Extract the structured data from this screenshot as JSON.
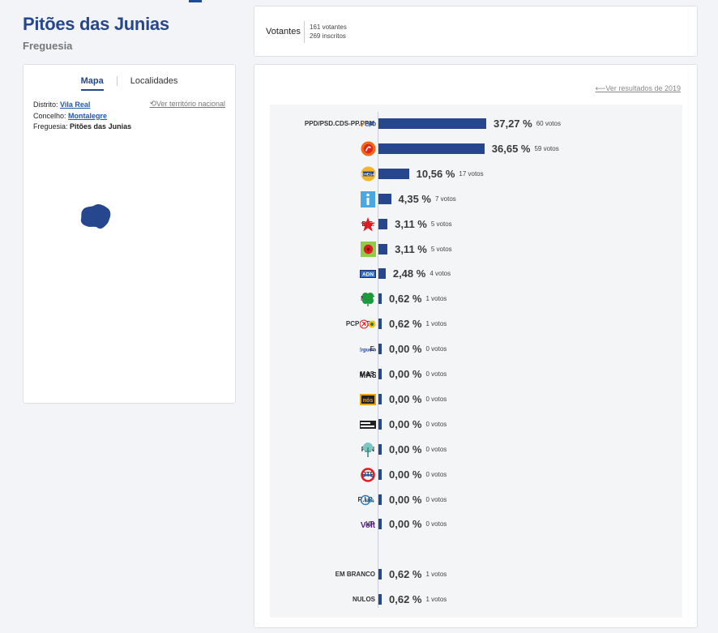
{
  "header": {
    "title": "Pitões das Junias",
    "subtitle": "Freguesia"
  },
  "left_panel": {
    "tabs": [
      {
        "label": "Mapa",
        "active": true
      },
      {
        "label": "Localidades",
        "active": false
      }
    ],
    "territory_link": "Ver território nacional",
    "info": {
      "distrito_label": "Distrito:",
      "distrito": "Vila Real",
      "concelho_label": "Concelho:",
      "concelho": "Montalegre",
      "freguesia_label": "Freguesia:",
      "freguesia": "Pitões das Junias"
    },
    "map_color": "#26478d"
  },
  "voters": {
    "label": "Votantes",
    "votantes": "161 votantes",
    "inscritos": "269 inscritos"
  },
  "results": {
    "previous_link": "Ver resultados de 2019",
    "accent": "#26478d",
    "chart_data": {
      "type": "bar",
      "orientation": "horizontal",
      "categories": [
        "PPD/PSD.CDS-PP.PPM",
        "PS",
        "CH",
        "IL",
        "B.E.",
        "L",
        "ADN",
        "MPT",
        "PCP-PEV",
        "E",
        "MAS",
        "NC",
        "ND",
        "PAN",
        "PTP",
        "R.I.R.",
        "VP",
        "EM BRANCO",
        "NULOS"
      ],
      "values": [
        37.27,
        36.65,
        10.56,
        4.35,
        3.11,
        3.11,
        2.48,
        0.62,
        0.62,
        0.0,
        0.0,
        0.0,
        0.0,
        0.0,
        0.0,
        0.0,
        0.0,
        0.62,
        0.62
      ],
      "value_labels": [
        "37,27 %",
        "36,65 %",
        "10,56 %",
        "4,35 %",
        "3,11 %",
        "3,11 %",
        "2,48 %",
        "0,62 %",
        "0,62 %",
        "0,00 %",
        "0,00 %",
        "0,00 %",
        "0,00 %",
        "0,00 %",
        "0,00 %",
        "0,00 %",
        "0,00 %",
        "0,62 %",
        "0,62 %"
      ],
      "votes": [
        "60 votos",
        "59 votos",
        "17 votos",
        "7 votos",
        "5 votos",
        "5 votos",
        "4 votos",
        "1 votos",
        "1 votos",
        "0 votos",
        "0 votos",
        "0 votos",
        "0 votos",
        "0 votos",
        "0 votos",
        "0 votos",
        "0 votos",
        "1 votos",
        "1 votos"
      ],
      "logos": [
        "ppd-psd-coalition-logo",
        "ps-logo",
        "chega-logo",
        "il-logo",
        "be-logo",
        "livre-logo",
        "adn-logo",
        "mpt-logo",
        "pcp-pev-logo",
        "ergue-te-logo",
        "mas-logo",
        "nc-logo",
        "nd-logo",
        "pan-logo",
        "ptp-logo",
        "rir-logo",
        "volt-logo",
        "",
        ""
      ]
    }
  }
}
